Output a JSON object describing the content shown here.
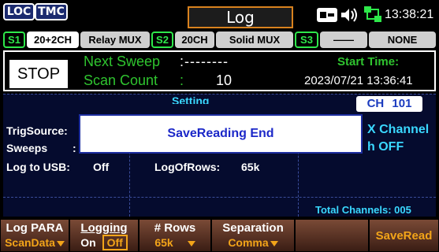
{
  "status": {
    "loc": "LOC",
    "tmc": "TMC",
    "title": "Log",
    "time": "13:38:21"
  },
  "slots": {
    "s1": "S1",
    "s1_card": "20+2CH",
    "s1_type": "Relay MUX",
    "s2": "S2",
    "s2_card": "20CH",
    "s2_type": "Solid MUX",
    "s3": "S3",
    "s3_card": "——",
    "s3_type": "NONE"
  },
  "top": {
    "stop_label": "STOP",
    "next_sweep_label": "Next Sweep",
    "next_sweep_value": ":--------",
    "scan_count_label": "Scan Count",
    "scan_count_colon": ":",
    "scan_count_value": "10",
    "start_time_label": "Start Time:",
    "start_time_value": "2023/07/21 13:36:41"
  },
  "settings": {
    "header": "Setting",
    "ch_label": "CH",
    "ch_value": "101",
    "trig_source_label": "TrigSource:",
    "sweeps_label": "Sweeps",
    "sweeps_colon": ":",
    "right_line1": "X Channel",
    "right_line2": "h OFF",
    "log_to_usb_label": "Log to USB:",
    "log_to_usb_value": "Off",
    "log_of_rows_label": "LogOfRows:",
    "log_of_rows_value": "65k",
    "total_channels": "Total Channels: 005"
  },
  "dialog": {
    "message": "SaveReading End"
  },
  "softkeys": [
    {
      "title": "Log PARA",
      "value": "ScanData"
    },
    {
      "title": "Logging",
      "value_on": "On",
      "value_off": "Off"
    },
    {
      "title": "# Rows",
      "value": "65k"
    },
    {
      "title": "Separation",
      "value": "Comma"
    },
    {
      "title": "",
      "value": ""
    },
    {
      "title": "",
      "value": "SaveRead"
    }
  ],
  "colors": {
    "accent_orange": "#f2a419",
    "green": "#2fc42f",
    "cyan": "#3ad8ff",
    "navy": "#050b2e"
  }
}
